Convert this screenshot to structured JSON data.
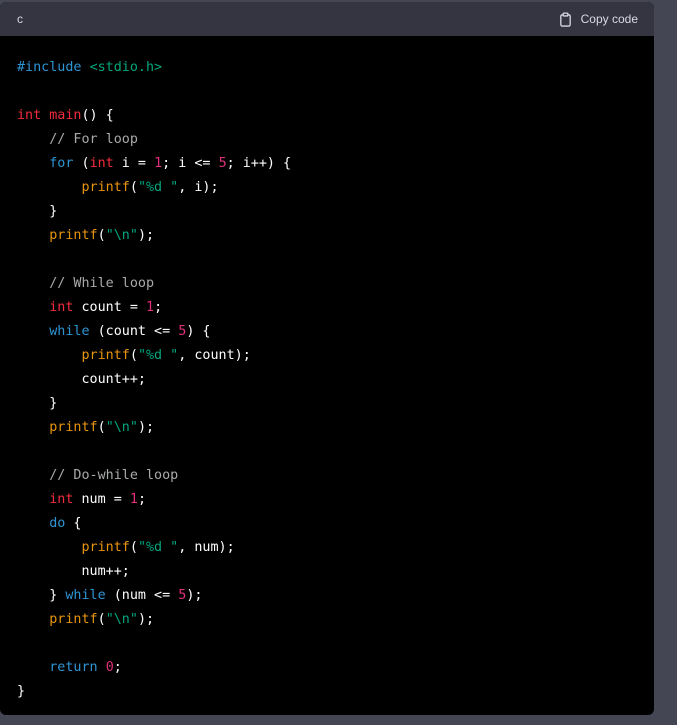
{
  "header": {
    "language": "c",
    "copy_label": "Copy code",
    "copy_icon": "clipboard-icon"
  },
  "colors": {
    "keyword": "#2e95d3",
    "type": "#f22c3d",
    "function_call": "#e9950c",
    "string": "#00a67d",
    "number": "#df3079",
    "comment": "#a9aaab",
    "plain": "#ffffff",
    "code_background": "#000000",
    "header_background": "#343541",
    "page_background": "#444654"
  },
  "code": {
    "lines": [
      [
        [
          "kw",
          "#include "
        ],
        [
          "str",
          "<stdio.h>"
        ]
      ],
      [],
      [
        [
          "type",
          "int"
        ],
        [
          "plain",
          " "
        ],
        [
          "fn",
          "main"
        ],
        [
          "plain",
          "() {"
        ]
      ],
      [
        [
          "plain",
          "    "
        ],
        [
          "cm",
          "// For loop"
        ]
      ],
      [
        [
          "plain",
          "    "
        ],
        [
          "kw",
          "for"
        ],
        [
          "plain",
          " ("
        ],
        [
          "type",
          "int"
        ],
        [
          "plain",
          " i = "
        ],
        [
          "num",
          "1"
        ],
        [
          "plain",
          "; i <= "
        ],
        [
          "num",
          "5"
        ],
        [
          "plain",
          "; i++) {"
        ]
      ],
      [
        [
          "plain",
          "        "
        ],
        [
          "call",
          "printf"
        ],
        [
          "plain",
          "("
        ],
        [
          "str",
          "\"%d \""
        ],
        [
          "plain",
          ", i);"
        ]
      ],
      [
        [
          "plain",
          "    }"
        ]
      ],
      [
        [
          "plain",
          "    "
        ],
        [
          "call",
          "printf"
        ],
        [
          "plain",
          "("
        ],
        [
          "str",
          "\"\\n\""
        ],
        [
          "plain",
          ");"
        ]
      ],
      [],
      [
        [
          "plain",
          "    "
        ],
        [
          "cm",
          "// While loop"
        ]
      ],
      [
        [
          "plain",
          "    "
        ],
        [
          "type",
          "int"
        ],
        [
          "plain",
          " count = "
        ],
        [
          "num",
          "1"
        ],
        [
          "plain",
          ";"
        ]
      ],
      [
        [
          "plain",
          "    "
        ],
        [
          "kw",
          "while"
        ],
        [
          "plain",
          " (count <= "
        ],
        [
          "num",
          "5"
        ],
        [
          "plain",
          ") {"
        ]
      ],
      [
        [
          "plain",
          "        "
        ],
        [
          "call",
          "printf"
        ],
        [
          "plain",
          "("
        ],
        [
          "str",
          "\"%d \""
        ],
        [
          "plain",
          ", count);"
        ]
      ],
      [
        [
          "plain",
          "        count++;"
        ]
      ],
      [
        [
          "plain",
          "    }"
        ]
      ],
      [
        [
          "plain",
          "    "
        ],
        [
          "call",
          "printf"
        ],
        [
          "plain",
          "("
        ],
        [
          "str",
          "\"\\n\""
        ],
        [
          "plain",
          ");"
        ]
      ],
      [],
      [
        [
          "plain",
          "    "
        ],
        [
          "cm",
          "// Do-while loop"
        ]
      ],
      [
        [
          "plain",
          "    "
        ],
        [
          "type",
          "int"
        ],
        [
          "plain",
          " num = "
        ],
        [
          "num",
          "1"
        ],
        [
          "plain",
          ";"
        ]
      ],
      [
        [
          "plain",
          "    "
        ],
        [
          "kw",
          "do"
        ],
        [
          "plain",
          " {"
        ]
      ],
      [
        [
          "plain",
          "        "
        ],
        [
          "call",
          "printf"
        ],
        [
          "plain",
          "("
        ],
        [
          "str",
          "\"%d \""
        ],
        [
          "plain",
          ", num);"
        ]
      ],
      [
        [
          "plain",
          "        num++;"
        ]
      ],
      [
        [
          "plain",
          "    } "
        ],
        [
          "kw",
          "while"
        ],
        [
          "plain",
          " (num <= "
        ],
        [
          "num",
          "5"
        ],
        [
          "plain",
          ");"
        ]
      ],
      [
        [
          "plain",
          "    "
        ],
        [
          "call",
          "printf"
        ],
        [
          "plain",
          "("
        ],
        [
          "str",
          "\"\\n\""
        ],
        [
          "plain",
          ");"
        ]
      ],
      [],
      [
        [
          "plain",
          "    "
        ],
        [
          "kw",
          "return"
        ],
        [
          "plain",
          " "
        ],
        [
          "num",
          "0"
        ],
        [
          "plain",
          ";"
        ]
      ],
      [
        [
          "plain",
          "}"
        ]
      ]
    ]
  }
}
